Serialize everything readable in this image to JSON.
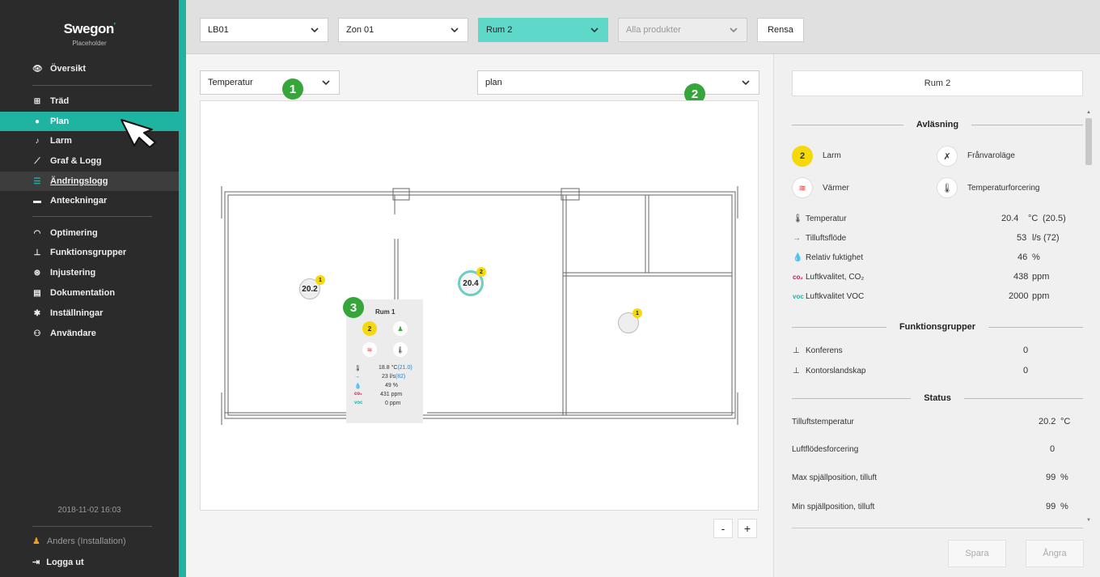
{
  "sidebar": {
    "brand": "Swegon",
    "subtitle": "Placeholder",
    "items": [
      {
        "label": "Översikt",
        "icon": "eye-icon"
      },
      {
        "label": "Träd",
        "icon": "tree-icon"
      },
      {
        "label": "Plan",
        "icon": "location-pin-icon"
      },
      {
        "label": "Larm",
        "icon": "bell-icon"
      },
      {
        "label": "Graf & Logg",
        "icon": "line-chart-icon"
      },
      {
        "label": "Ändringslogg",
        "icon": "list-icon"
      },
      {
        "label": "Anteckningar",
        "icon": "comment-icon"
      },
      {
        "label": "Optimering",
        "icon": "gauge-icon"
      },
      {
        "label": "Funktionsgrupper",
        "icon": "hierarchy-icon"
      },
      {
        "label": "Injustering",
        "icon": "fan-icon"
      },
      {
        "label": "Dokumentation",
        "icon": "document-icon"
      },
      {
        "label": "Inställningar",
        "icon": "gear-icon"
      },
      {
        "label": "Användare",
        "icon": "users-icon"
      }
    ],
    "datetime": "2018-11-02 16:03",
    "user": "Anders (Installation)",
    "logout": "Logga ut"
  },
  "topbar": {
    "filter_lb": "LB01",
    "filter_zone": "Zon 01",
    "filter_room": "Rum 2",
    "filter_products": "Alla produkter",
    "clear_button": "Rensa"
  },
  "main": {
    "view_select": "Temperatur",
    "layer_select": "plan",
    "badges": [
      "1",
      "2",
      "3"
    ],
    "sensors": [
      {
        "value": "20.2",
        "alarm": "1"
      },
      {
        "value": "20.4",
        "alarm": "2"
      },
      {
        "value": "",
        "alarm": "1"
      }
    ],
    "popup": {
      "title": "Rum 1",
      "alarm_count": "2",
      "temperature": "18.8 °C",
      "temperature_setpoint": "(21.0)",
      "flow": "23 l/s",
      "flow_setpoint": "(82)",
      "humidity": "49 %",
      "co2": "431 ppm",
      "voc": "0 ppm",
      "co2_label": "co₂",
      "voc_label": "voc"
    },
    "zoom_out": "-",
    "zoom_in": "+"
  },
  "panel": {
    "room_title": "Rum 2",
    "section_reading": "Avläsning",
    "alarm_count": "2",
    "alarm_label": "Larm",
    "absence_label": "Frånvaroläge",
    "heater_label": "Värmer",
    "temp_force_label": "Temperaturforcering",
    "readings": [
      {
        "label": "Temperatur",
        "value": "20.4",
        "unit": "°C",
        "setpoint": "(20.5)",
        "icon": "thermometer-icon",
        "icon_text": "🌡"
      },
      {
        "label": "Tilluftsflöde",
        "value": "53",
        "unit": "l/s",
        "setpoint": "(72)",
        "icon": "arrow-right-icon",
        "icon_text": "→"
      },
      {
        "label": "Relativ fuktighet",
        "value": "46",
        "unit": "%",
        "setpoint": "",
        "icon": "droplet-icon",
        "icon_text": "💧"
      },
      {
        "label": "Luftkvalitet, CO₂",
        "value": "438",
        "unit": "ppm",
        "setpoint": "",
        "icon": "co2-icon",
        "icon_text": "co₂"
      },
      {
        "label": "Luftkvalitet VOC",
        "value": "2000",
        "unit": "ppm",
        "setpoint": "",
        "icon": "voc-icon",
        "icon_text": "voc"
      }
    ],
    "section_groups": "Funktionsgrupper",
    "groups": [
      {
        "label": "Konferens",
        "value": "0"
      },
      {
        "label": "Kontorslandskap",
        "value": "0"
      }
    ],
    "section_status": "Status",
    "status": [
      {
        "label": "Tilluftstemperatur",
        "value": "20.2",
        "unit": "°C"
      },
      {
        "label": "Luftflödesforcering",
        "value": "0",
        "unit": ""
      },
      {
        "label": "Max spjällposition, tilluft",
        "value": "99",
        "unit": "%"
      },
      {
        "label": "Min spjällposition, tilluft",
        "value": "99",
        "unit": "%"
      }
    ],
    "save_button": "Spara",
    "undo_button": "Ångra"
  },
  "colors": {
    "accent": "#1fb3a2",
    "sidebar_bg": "#2b2b2b",
    "badge_green": "#36a63a",
    "alarm_yellow": "#f5d90a",
    "setpoint_blue": "#2a7fc4"
  }
}
